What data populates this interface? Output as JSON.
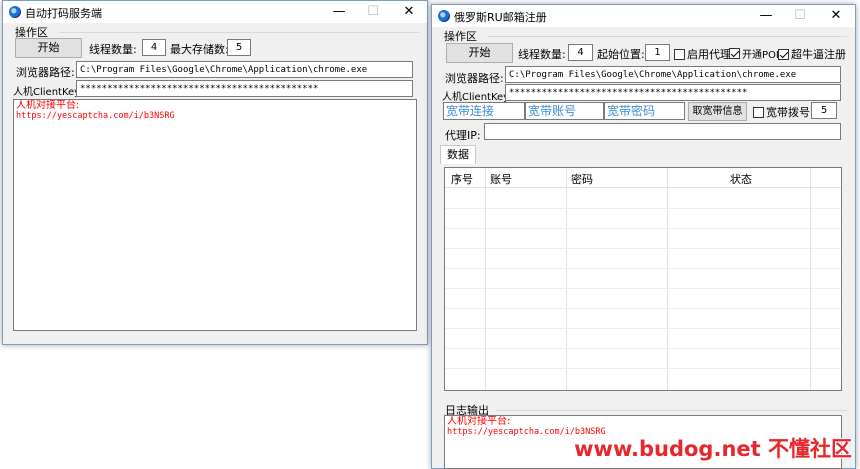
{
  "left_window": {
    "title": "自动打码服务端",
    "controls": {
      "minimize": "—",
      "maximize": "☐",
      "close": "✕"
    },
    "group_title": "操作区",
    "start_button": "开始",
    "thread_label": "线程数量:",
    "thread_value": "4",
    "max_store_label": "最大存储数:",
    "max_store_value": "5",
    "browser_path_label": "浏览器路径:",
    "browser_path_value": "C:\\Program Files\\Google\\Chrome\\Application\\chrome.exe",
    "client_key_label": "人机ClientKey",
    "client_key_value": "********************************************",
    "log_lines": [
      "人机对接平台:",
      "https://yescaptcha.com/i/b3NSRG"
    ]
  },
  "right_window": {
    "title": "俄罗斯RU邮箱注册",
    "controls": {
      "minimize": "—",
      "maximize": "☐",
      "close": "✕"
    },
    "group_title": "操作区",
    "start_button": "开始",
    "thread_label": "线程数量:",
    "thread_value": "4",
    "start_pos_label": "起始位置:",
    "start_pos_value": "1",
    "proxy_checkbox": {
      "label": "启用代理",
      "checked": false
    },
    "pop_checkbox": {
      "label": "开通POP",
      "checked": true
    },
    "superbull_checkbox": {
      "label": "超牛逼注册",
      "checked": true
    },
    "browser_path_label": "浏览器路径:",
    "browser_path_value": "C:\\Program Files\\Google\\Chrome\\Application\\chrome.exe",
    "client_key_label": "人机ClientKey",
    "client_key_value": "********************************************",
    "broadband_connect": "宽带连接",
    "broadband_account": "宽带账号",
    "broadband_password": "宽带密码",
    "get_broadband_button": "取宽带信息",
    "dialup_checkbox": {
      "label": "宽带拨号",
      "checked": false
    },
    "dialup_value": "5",
    "proxy_ip_label": "代理IP:",
    "proxy_ip_value": "",
    "data_tab": "数据",
    "table_headers": [
      "序号",
      "账号",
      "密码",
      "状态"
    ],
    "log_group_title": "日志输出",
    "log_lines": [
      "人机对接平台:",
      "https://yescaptcha.com/i/b3NSRG"
    ]
  },
  "watermark": "www.budog.net 不懂社区"
}
